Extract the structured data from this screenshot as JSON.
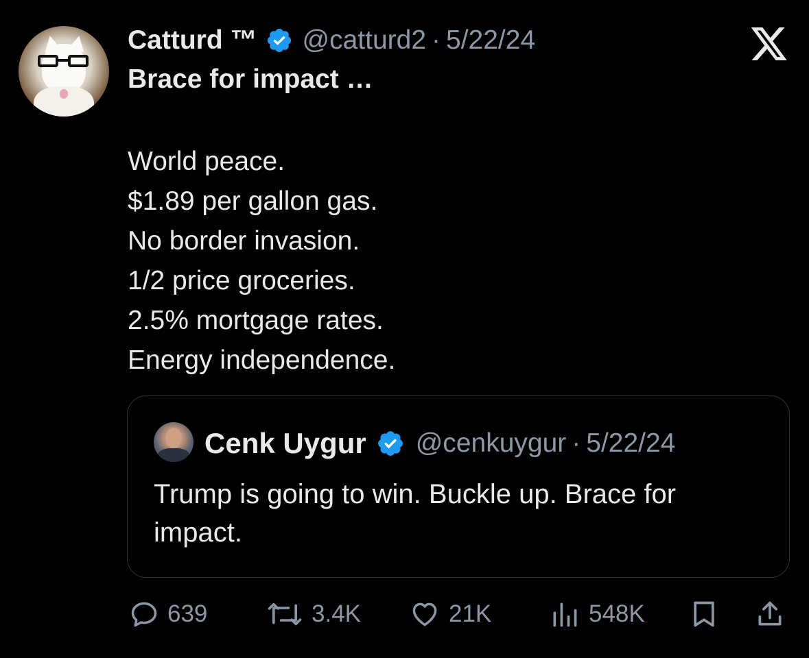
{
  "tweet": {
    "author_name": "Catturd ™",
    "handle": "@catturd2",
    "separator": "·",
    "date": "5/22/24",
    "headline": "Brace for impact …",
    "lines": [
      "World peace.",
      "$1.89 per gallon gas.",
      "No border invasion.",
      "1/2 price groceries.",
      "2.5% mortgage rates.",
      "Energy independence."
    ]
  },
  "quote": {
    "author_name": "Cenk Uygur",
    "handle": "@cenkuygur",
    "separator": "·",
    "date": "5/22/24",
    "text": "Trump is going to win. Buckle up. Brace for impact."
  },
  "actions": {
    "replies": "639",
    "reposts": "3.4K",
    "likes": "21K",
    "views": "548K"
  },
  "icons": {
    "verified": "verified-badge-icon",
    "brand": "x-logo-icon",
    "reply": "reply-icon",
    "repost": "repost-icon",
    "like": "heart-icon",
    "views": "views-chart-icon",
    "bookmark": "bookmark-icon",
    "share": "share-icon"
  },
  "colors": {
    "background": "#000000",
    "text": "#e7e9ea",
    "muted": "#8b98a5",
    "verified": "#1d9bf0",
    "border": "#2f3336"
  }
}
